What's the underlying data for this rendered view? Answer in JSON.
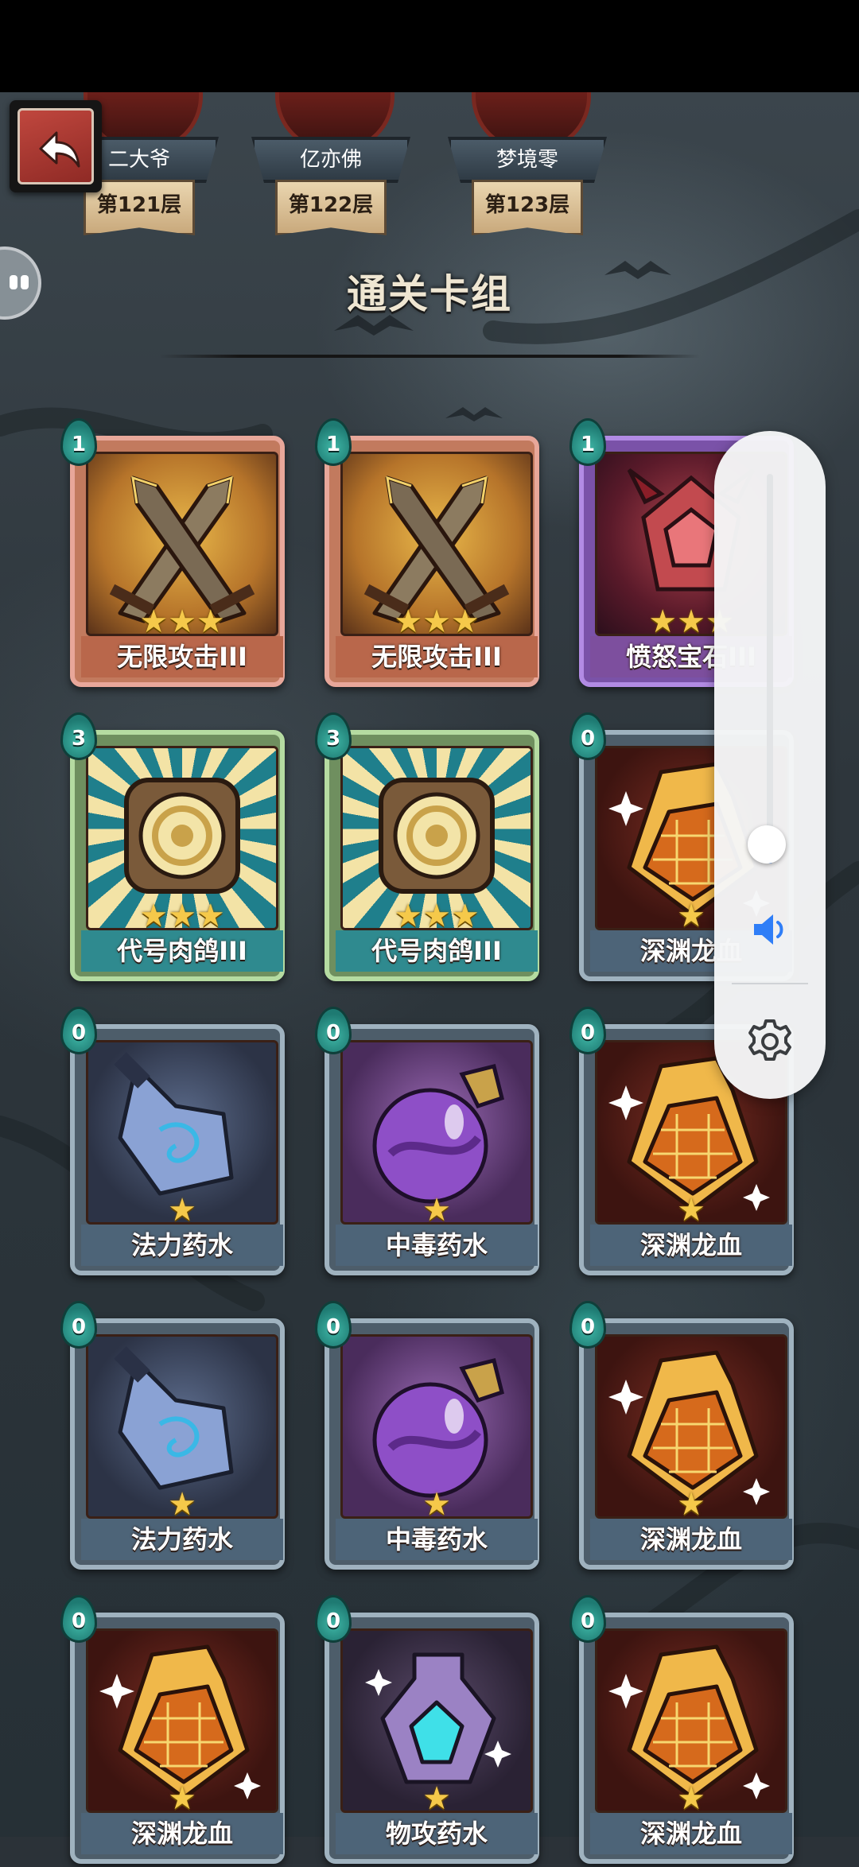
{
  "header": {
    "bosses": [
      {
        "name": "二大爷",
        "floor": "第121层"
      },
      {
        "name": "亿亦佛",
        "floor": "第122层"
      },
      {
        "name": "梦境零",
        "floor": "第123层"
      }
    ]
  },
  "section_title": "通关卡组",
  "cards": [
    {
      "name": "无限攻击III",
      "cost": "1",
      "stars": 3,
      "style": "gold",
      "art": "crossed-swords"
    },
    {
      "name": "无限攻击III",
      "cost": "1",
      "stars": 3,
      "style": "gold",
      "art": "crossed-swords"
    },
    {
      "name": "愤怒宝石III",
      "cost": "1",
      "stars": 3,
      "style": "purple",
      "art": "rage-gem"
    },
    {
      "name": "代号肉鸽III",
      "cost": "3",
      "stars": 3,
      "style": "teal",
      "art": "golden-seal"
    },
    {
      "name": "代号肉鸽III",
      "cost": "3",
      "stars": 3,
      "style": "teal",
      "art": "golden-seal"
    },
    {
      "name": "深渊龙血",
      "cost": "0",
      "stars": 1,
      "style": "steel",
      "art": "dragon-blood-flask"
    },
    {
      "name": "法力药水",
      "cost": "0",
      "stars": 1,
      "style": "steel",
      "art": "mana-potion"
    },
    {
      "name": "中毒药水",
      "cost": "0",
      "stars": 1,
      "style": "steel",
      "art": "poison-potion"
    },
    {
      "name": "深渊龙血",
      "cost": "0",
      "stars": 1,
      "style": "steel",
      "art": "dragon-blood-flask"
    },
    {
      "name": "法力药水",
      "cost": "0",
      "stars": 1,
      "style": "steel",
      "art": "mana-potion"
    },
    {
      "name": "中毒药水",
      "cost": "0",
      "stars": 1,
      "style": "steel",
      "art": "poison-potion"
    },
    {
      "name": "深渊龙血",
      "cost": "0",
      "stars": 1,
      "style": "steel",
      "art": "dragon-blood-flask"
    },
    {
      "name": "深渊龙血",
      "cost": "0",
      "stars": 1,
      "style": "steel",
      "art": "dragon-blood-flask"
    },
    {
      "name": "物攻药水",
      "cost": "0",
      "stars": 1,
      "style": "steel",
      "art": "attack-potion"
    },
    {
      "name": "深渊龙血",
      "cost": "0",
      "stars": 1,
      "style": "steel",
      "art": "dragon-blood-flask"
    }
  ],
  "volume_panel": {
    "level": 0.05,
    "accent": "#2f7ef7"
  },
  "icons": {
    "back": "back-arrow-icon",
    "volume": "speaker-icon",
    "settings": "gear-icon"
  }
}
